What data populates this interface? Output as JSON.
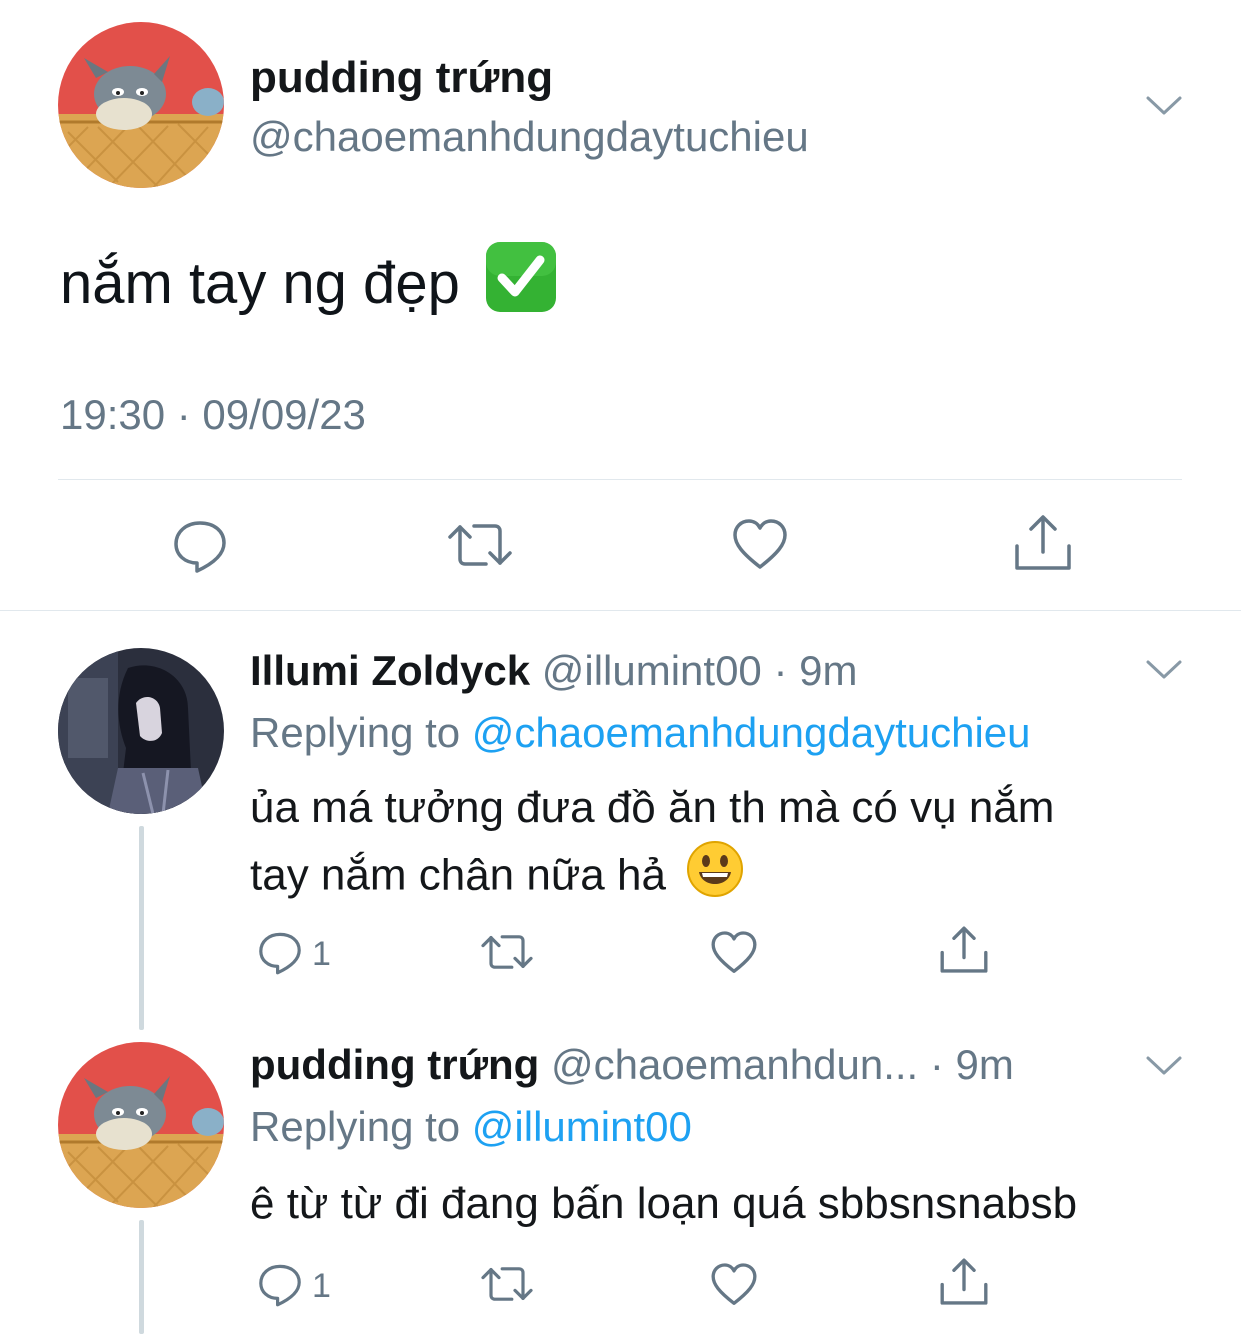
{
  "main_tweet": {
    "display_name": "pudding trứng",
    "handle": "@chaoemanhdungdaytuchieu",
    "text": "nắm tay ng đẹp",
    "emoji": "check-mark-button-emoji",
    "timestamp": "19:30 · 09/09/23"
  },
  "replies": [
    {
      "display_name": "Illumi Zoldyck",
      "handle": "@illumint00",
      "time": "· 9m",
      "replying_prefix": "Replying to",
      "replying_to": "@chaoemanhdungdaytuchieu",
      "text_line1": "ủa má tưởng đưa đồ ăn th mà có vụ nắm",
      "text_line2": "tay nắm chân nữa hả",
      "emoji": "smiley-emoji",
      "reply_count": "1"
    },
    {
      "display_name": "pudding trứng",
      "handle": "@chaoemanhdun...",
      "time": "· 9m",
      "replying_prefix": "Replying to",
      "replying_to": "@illumint00",
      "text_line1": "ê từ từ đi đang bấn loạn quá sbbsnsnabsb",
      "reply_count": "1"
    }
  ],
  "colors": {
    "link_blue": "#1da1f2",
    "secondary_gray": "#657786",
    "icon_gray": "#657786",
    "divider": "#e1e8ed",
    "check_green": "#34b233"
  }
}
